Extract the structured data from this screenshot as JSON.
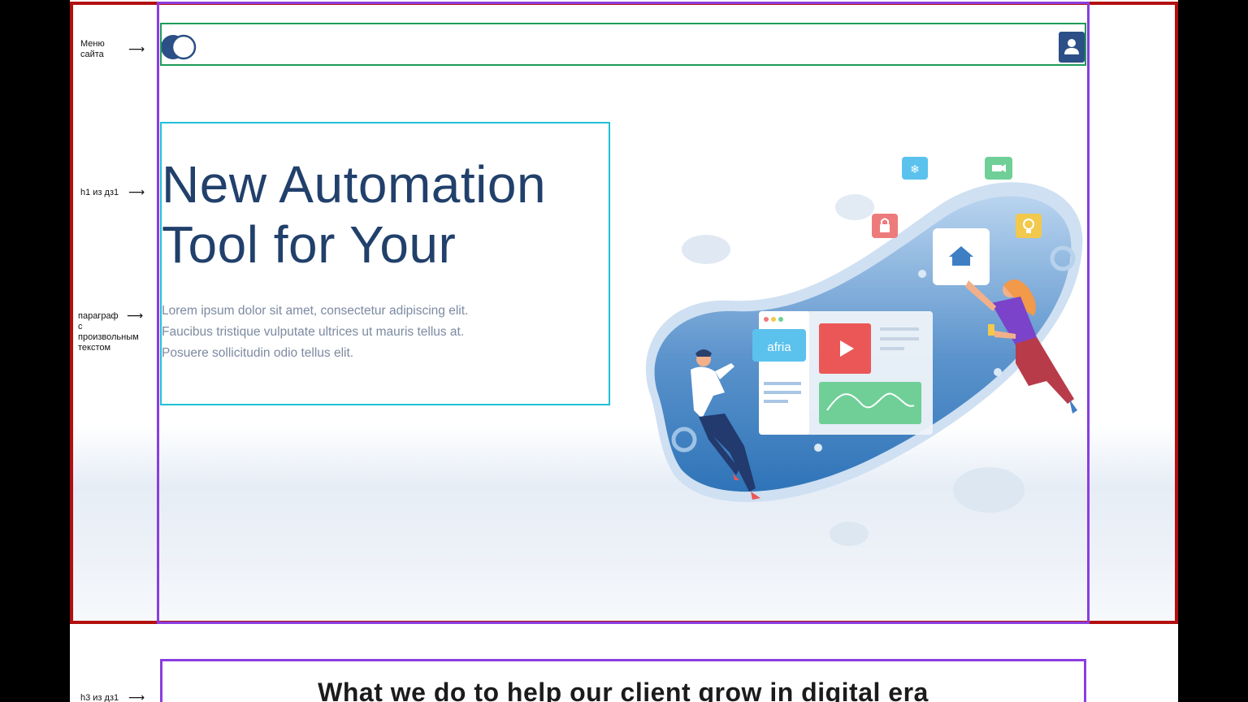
{
  "annotations": {
    "menu": "Меню\nсайта",
    "h1": "h1 из дз1",
    "paragraph": "параграф\nс\nпроизвольным\nтекстом",
    "h3": "h3 из дз1"
  },
  "arrows": {
    "glyph": "⟶"
  },
  "header": {
    "toggle_icon": "toggle-icon",
    "user_icon": "user-icon"
  },
  "hero": {
    "title": "New Automation Tool for Your",
    "paragraph": "Lorem ipsum dolor sit amet, consectetur adipiscing elit. Faucibus tristique vulputate ultrices ut mauris tellus at. Posuere sollicitudin odio tellus elit.",
    "illustration": {
      "badge_label": "afria"
    }
  },
  "section": {
    "title": "What we do to help our client grow in digital era"
  },
  "colors": {
    "red_frame": "#b30f0f",
    "purple_frame": "#8a3de0",
    "green_frame": "#1e9a5a",
    "cyan_frame": "#1ec0d6",
    "title": "#21406b",
    "paragraph": "#7c8aa1",
    "accent_blue": "#2b4f86"
  }
}
